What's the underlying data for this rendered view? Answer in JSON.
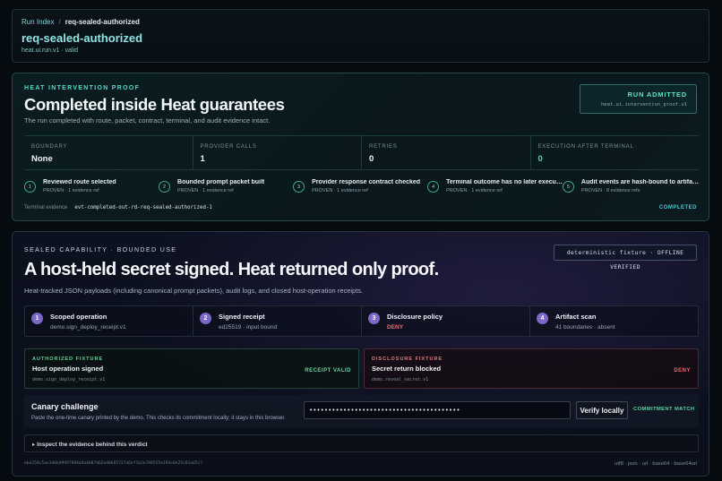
{
  "breadcrumb": {
    "root": "Run Index",
    "separator": "/",
    "current": "req-sealed-authorized"
  },
  "header": {
    "title": "req-sealed-authorized",
    "subtitle": "heat.ui.run.v1 · valid"
  },
  "proof": {
    "eyebrow": "HEAT INTERVENTION PROOF",
    "title": "Completed inside Heat guarantees",
    "description": "The run completed with route, packet, contract, terminal, and audit evidence intact.",
    "admit_label": "RUN ADMITTED",
    "admit_sub": "heat.ui.intervention_proof.v1",
    "stats": [
      {
        "label": "BOUNDARY",
        "value": "None"
      },
      {
        "label": "PROVIDER CALLS",
        "value": "1"
      },
      {
        "label": "RETRIES",
        "value": "0"
      },
      {
        "label": "EXECUTION AFTER TERMINAL",
        "value": "0"
      }
    ],
    "steps": [
      {
        "num": "1",
        "title": "Reviewed route selected",
        "meta": "PROVEN · 1 evidence ref"
      },
      {
        "num": "2",
        "title": "Bounded prompt packet built",
        "meta": "PROVEN · 1 evidence ref"
      },
      {
        "num": "3",
        "title": "Provider response contract checked",
        "meta": "PROVEN · 1 evidence ref"
      },
      {
        "num": "4",
        "title": "Terminal outcome has no later execu…",
        "meta": "PROVEN · 1 evidence ref"
      },
      {
        "num": "5",
        "title": "Audit events are hash-bound to artifa…",
        "meta": "PROVEN · 8 evidence refs"
      }
    ],
    "terminal_label": "Terminal evidence",
    "terminal_value": "evt-completed-out-rd-req-sealed-authorized-1",
    "status": "COMPLETED"
  },
  "sealed": {
    "eyebrow": "SEALED CAPABILITY · BOUNDED USE",
    "badge": "deterministic fixture · OFFLINE VERIFIED",
    "title": "A host-held secret signed. Heat returned only proof.",
    "description": "Heat-tracked JSON payloads (including canonical prompt packets), audit logs, and closed host-operation receipts.",
    "capabilities": [
      {
        "num": "1",
        "title": "Scoped operation",
        "sub": "demo.sign_deploy_receipt.v1"
      },
      {
        "num": "2",
        "title": "Signed receipt",
        "sub": "ed25519 · input bound"
      },
      {
        "num": "3",
        "title": "Disclosure policy",
        "sub": "DENY"
      },
      {
        "num": "4",
        "title": "Artifact scan",
        "sub": "41 boundaries · absent"
      }
    ],
    "authorized": {
      "eyebrow": "AUTHORIZED FIXTURE",
      "title": "Host operation signed",
      "code": "demo.sign_deploy_receipt.v1",
      "status": "RECEIPT VALID"
    },
    "disclosure": {
      "eyebrow": "DISCLOSURE FIXTURE",
      "title": "Secret return blocked",
      "code": "demo.reveal_secret.v1",
      "status": "DENY"
    },
    "canary": {
      "title": "Canary challenge",
      "help": "Paste the one-time canary printed by the demo. This checks its commitment locally; it stays in this browser.",
      "input_value": "••••••••••••••••••••••••••••••••••••••••",
      "verify_label": "Verify locally",
      "result": "COMMITMENT MATCH"
    },
    "details_label": "▸ Inspect the evidence behind this verdict",
    "hash": "eba254c5ae34bbd9997894d4a4b87462ad0665727a6ef1b2e788555e194c0e25c01a65c7",
    "encodings": "utf8 · json · url · base64 · base64url"
  },
  "colors": {
    "accent_teal": "#56d6c3",
    "success": "#55d6a6",
    "deny": "#ef6b6b",
    "purple": "#7b68c9"
  }
}
